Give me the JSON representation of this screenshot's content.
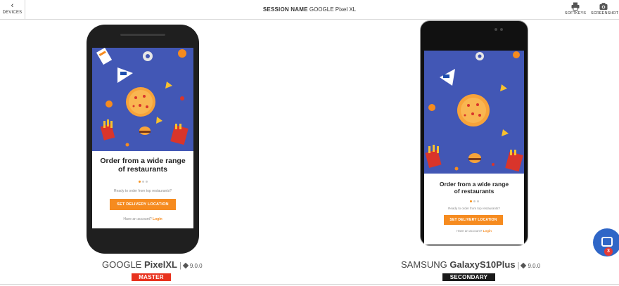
{
  "topbar": {
    "back_label": "DEVICES",
    "session_key": "SESSION NAME",
    "session_value": "GOOGLE Pixel XL",
    "softkeys_label": "SOFTKEYS",
    "screenshot_label": "SCREENSHOT"
  },
  "app_screen": {
    "headline_line1": "Order from a wide range",
    "headline_line2": "of restaurants",
    "subtext": "Ready to order from top restaurants?",
    "cta": "SET DELIVERY LOCATION",
    "login_prompt": "Have an account?",
    "login_link": "Login"
  },
  "devices": [
    {
      "brand": "GOOGLE",
      "model": "PixelXL",
      "version": "9.0.0",
      "role": "MASTER"
    },
    {
      "brand": "SAMSUNG",
      "model": "GalaxyS10Plus",
      "version": "9.0.0",
      "role": "SECONDARY"
    }
  ],
  "chat": {
    "unread": "3"
  },
  "colors": {
    "accent": "#f68b1f",
    "art_bg": "#4257b5",
    "master": "#e8321e",
    "secondary": "#1a1a1a",
    "chat": "#2f66c7"
  }
}
